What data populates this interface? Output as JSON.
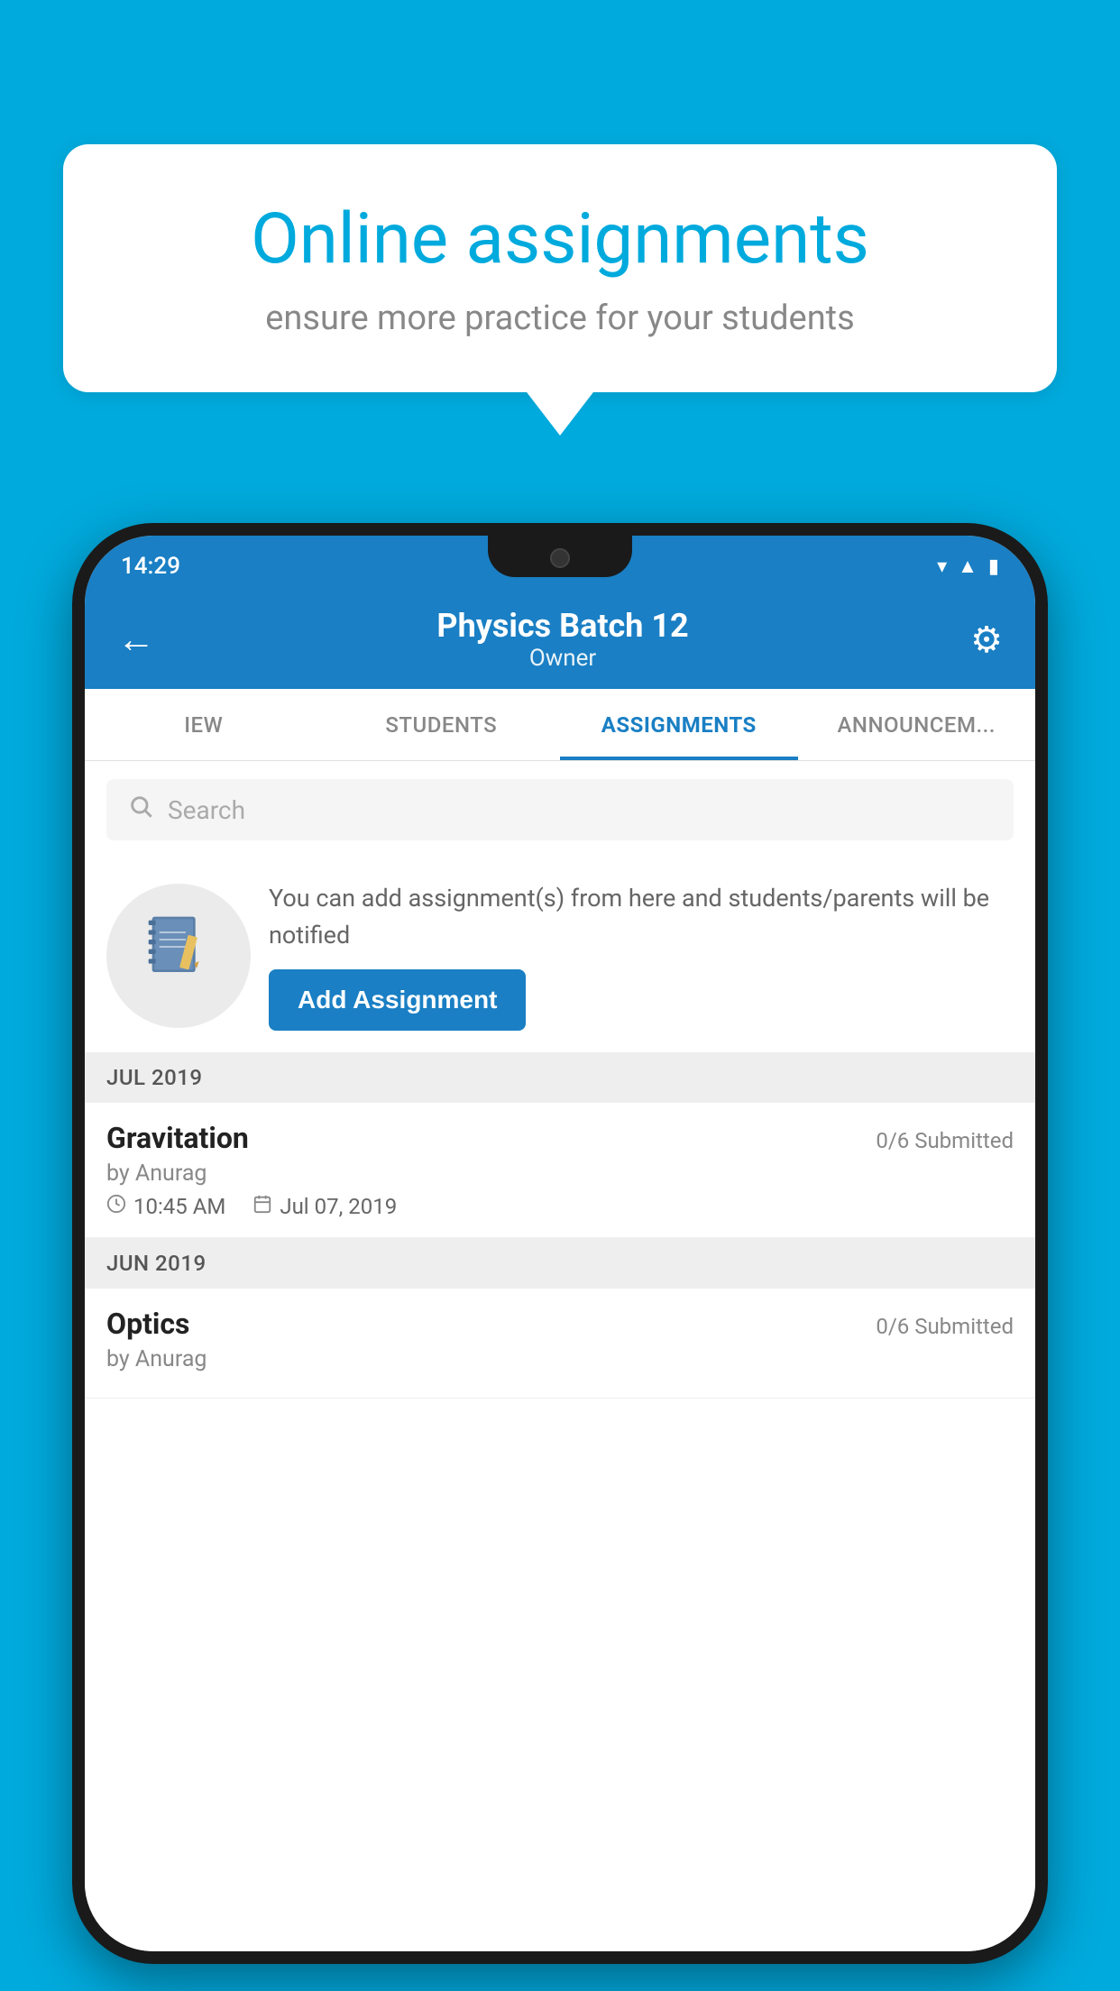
{
  "background_color": "#00AADD",
  "speech_bubble": {
    "title": "Online assignments",
    "subtitle": "ensure more practice for your students"
  },
  "phone": {
    "status_bar": {
      "time": "14:29",
      "icons": [
        "wifi",
        "signal",
        "battery"
      ]
    },
    "header": {
      "title": "Physics Batch 12",
      "subtitle": "Owner",
      "back_label": "←",
      "settings_label": "⚙"
    },
    "tabs": [
      {
        "label": "IEW",
        "active": false
      },
      {
        "label": "STUDENTS",
        "active": false
      },
      {
        "label": "ASSIGNMENTS",
        "active": true
      },
      {
        "label": "ANNOUNCEM...",
        "active": false
      }
    ],
    "search": {
      "placeholder": "Search"
    },
    "promo": {
      "description": "You can add assignment(s) from here and students/parents will be notified",
      "add_button_label": "Add Assignment"
    },
    "sections": [
      {
        "header": "JUL 2019",
        "assignments": [
          {
            "name": "Gravitation",
            "submitted": "0/6 Submitted",
            "by": "by Anurag",
            "time": "10:45 AM",
            "date": "Jul 07, 2019"
          }
        ]
      },
      {
        "header": "JUN 2019",
        "assignments": [
          {
            "name": "Optics",
            "submitted": "0/6 Submitted",
            "by": "by Anurag",
            "time": "",
            "date": ""
          }
        ]
      }
    ]
  }
}
